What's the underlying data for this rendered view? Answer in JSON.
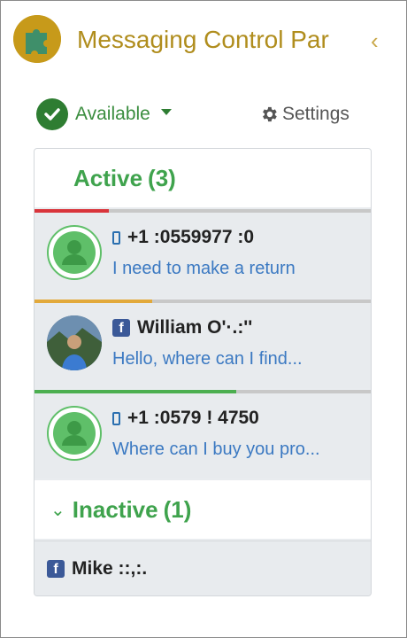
{
  "header": {
    "title": "Messaging Control Par",
    "collapse_glyph": "‹",
    "logo_icon": "puzzle-logo-icon"
  },
  "status": {
    "label": "Available",
    "icon": "check-circle-icon"
  },
  "settings": {
    "label": "Settings",
    "icon": "gear-icon"
  },
  "active": {
    "label": "Active",
    "count": "(3)",
    "conversations": [
      {
        "channel": "sms",
        "name": "+1 :0559977 :0",
        "message": "I need to make a return",
        "bar_color": "#d9343b",
        "bar_fraction": 0.22
      },
      {
        "channel": "facebook",
        "name": "William O'·.:''",
        "message": "Hello, where can I find...",
        "bar_color": "#e2a93b",
        "bar_fraction": 0.35
      },
      {
        "channel": "sms",
        "name": "+1 :0579 ! 4750",
        "message": "Where can I buy you pro...",
        "bar_color": "#4caf50",
        "bar_fraction": 0.6
      }
    ]
  },
  "inactive": {
    "label": "Inactive",
    "count": "(1)",
    "chevron": "⌄",
    "items": [
      {
        "channel": "facebook",
        "name": "Mike ::,:."
      }
    ]
  },
  "colors": {
    "accent_gold": "#b08d1d",
    "accent_green": "#3fa34d",
    "link_blue": "#3b79c2",
    "facebook_blue": "#3b5998"
  }
}
